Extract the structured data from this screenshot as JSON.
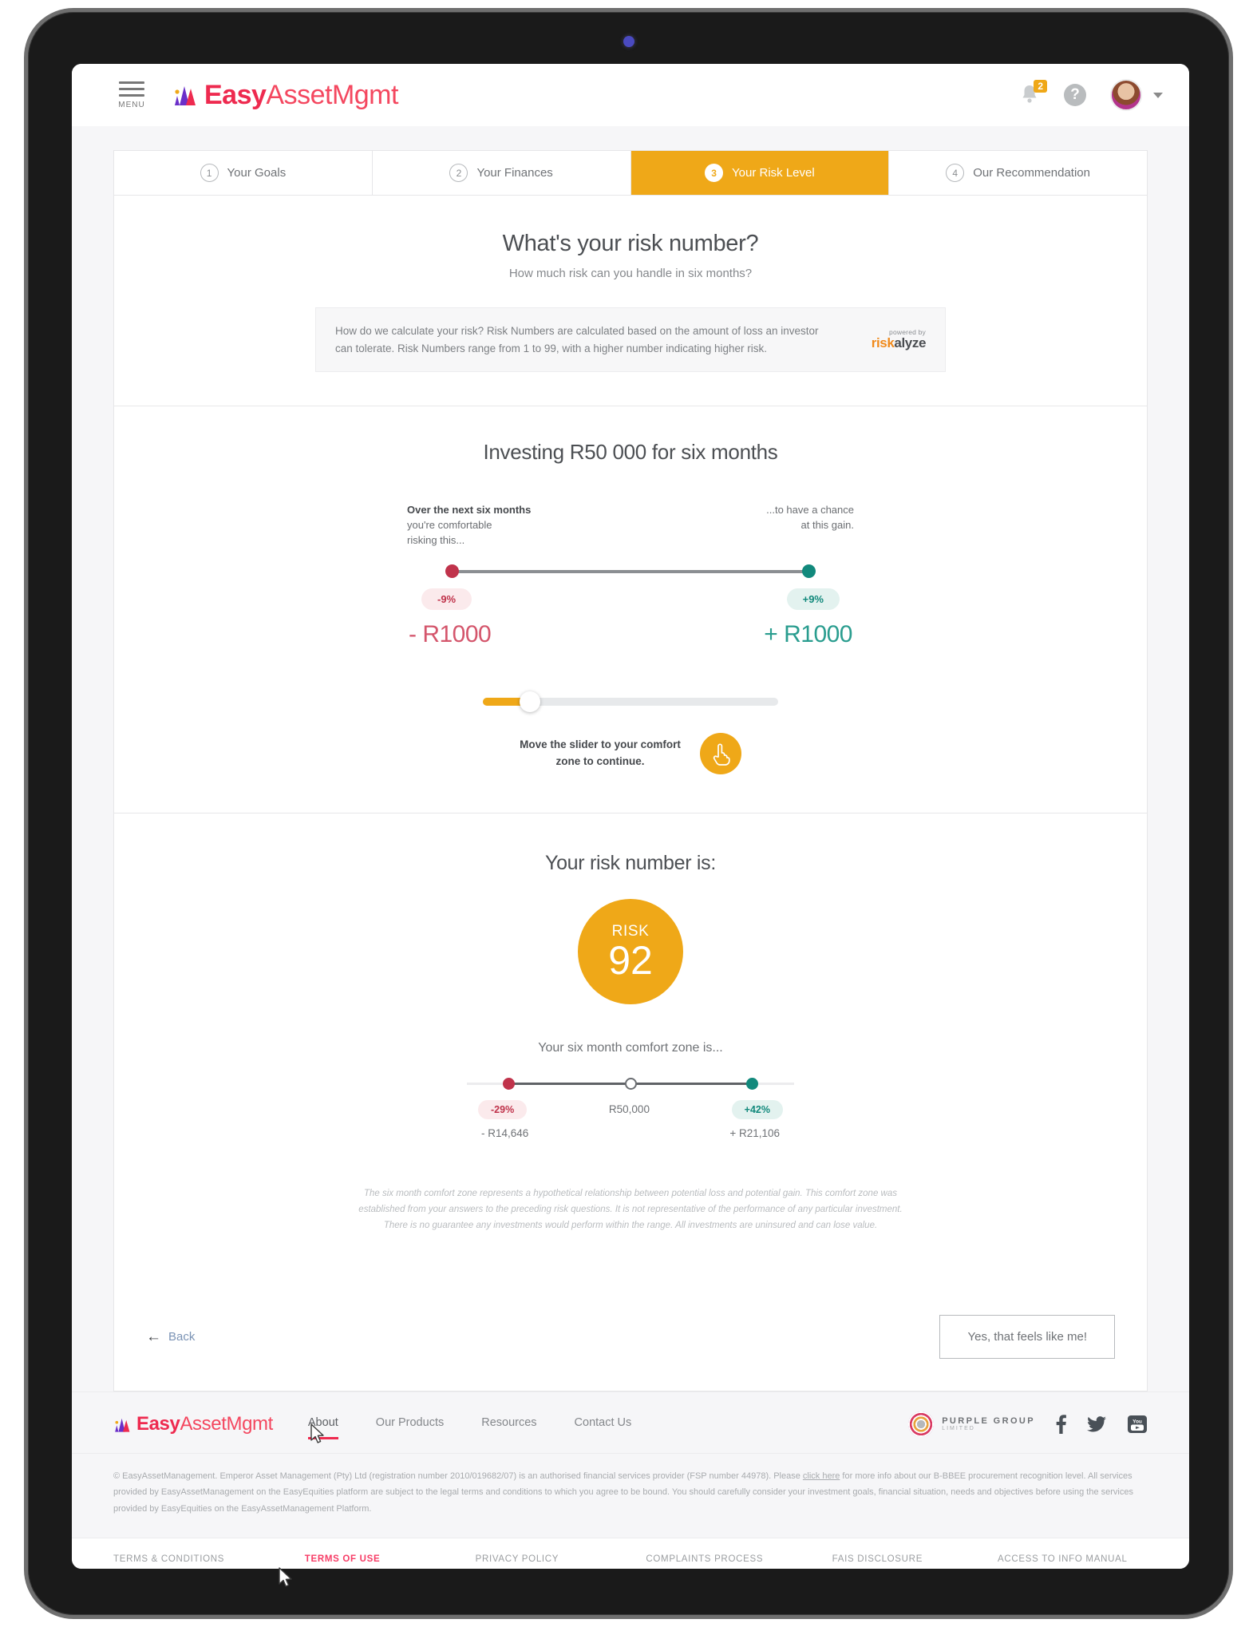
{
  "topnav": {
    "menu_label": "MENU",
    "brand_bold": "Easy",
    "brand_light": "AssetMgmt",
    "notification_count": "2",
    "help_label": "?"
  },
  "steps": [
    {
      "num": "1",
      "label": "Your Goals",
      "active": false
    },
    {
      "num": "2",
      "label": "Your Finances",
      "active": false
    },
    {
      "num": "3",
      "label": "Your Risk Level",
      "active": true
    },
    {
      "num": "4",
      "label": "Our Recommendation",
      "active": false
    }
  ],
  "intro": {
    "title": "What's your risk number?",
    "subtitle": "How much risk can you handle in six months?",
    "info_text": "How do we calculate your risk? Risk Numbers are calculated based on the amount of loss an investor can tolerate. Risk Numbers range from 1 to 99, with a higher number indicating higher risk.",
    "riskalyze_powered": "powered by",
    "riskalyze_risk": "risk",
    "riskalyze_alyze": "alyze"
  },
  "invest": {
    "title": "Investing R50 000 for six months",
    "left_line1": "Over the next six months",
    "left_line2": "you're comfortable",
    "left_line3": "risking this...",
    "right_line1": "...to have a chance",
    "right_line2": "at this gain.",
    "loss_pct": "-9%",
    "gain_pct": "+9%",
    "loss_amount": "- R1000",
    "gain_amount": "+ R1000",
    "slider_value_pct": 16,
    "slider_hint_line1": "Move the slider to your comfort",
    "slider_hint_line2": "zone to continue."
  },
  "risk": {
    "heading": "Your risk number is:",
    "badge_word": "RISK",
    "badge_value": "92",
    "comfort_heading": "Your six month comfort zone is...",
    "comfort_loss_pct": "-29%",
    "comfort_mid_label": "R50,000",
    "comfort_gain_pct": "+42%",
    "comfort_loss_amount": "- R14,646",
    "comfort_gain_amount": "+ R21,106",
    "disclaimer": "The six month comfort zone represents a hypothetical relationship between potential loss and potential gain. This comfort zone was established from your answers to the preceding risk questions. It is not representative of the performance of any particular investment. There is no guarantee any investments would perform within the range. All investments are uninsured and can lose value."
  },
  "actions": {
    "back_label": "Back",
    "back_arrow": "←",
    "cta_label": "Yes, that feels like me!"
  },
  "footer": {
    "brand_bold": "Easy",
    "brand_light": "AssetMgmt",
    "links": [
      {
        "label": "About",
        "hovered": true
      },
      {
        "label": "Our Products",
        "hovered": false
      },
      {
        "label": "Resources",
        "hovered": false
      },
      {
        "label": "Contact Us",
        "hovered": false
      }
    ],
    "partner_name": "PURPLE GROUP",
    "partner_sub": "LIMITED",
    "legal_text_part1": "© EasyAssetManagement. Emperor Asset Management (Pty) Ltd (registration number 2010/019682/07) is an authorised financial services provider (FSP number 44978). Please ",
    "legal_link": "click here",
    "legal_text_part2": " for more info about our B-BBEE procurement recognition level. All services provided by EasyAssetManagement on the EasyEquities platform are subject to the legal terms and conditions to which you agree to be bound. You should carefully consider your investment goals, financial situation, needs and objectives before using the services provided by EasyEquities on the EasyAssetManagement Platform.",
    "legal_links": [
      {
        "label": "TERMS & CONDITIONS",
        "active": false
      },
      {
        "label": "TERMS OF USE",
        "active": true
      },
      {
        "label": "PRIVACY POLICY",
        "active": false
      },
      {
        "label": "COMPLAINTS PROCESS",
        "active": false
      },
      {
        "label": "FAIS DISCLOSURE",
        "active": false
      },
      {
        "label": "ACCESS TO INFO MANUAL",
        "active": false
      }
    ]
  },
  "colors": {
    "accent_orange": "#efa818",
    "brand_red": "#ee2a4f",
    "loss_red": "#c0334b",
    "gain_teal": "#12897c"
  }
}
